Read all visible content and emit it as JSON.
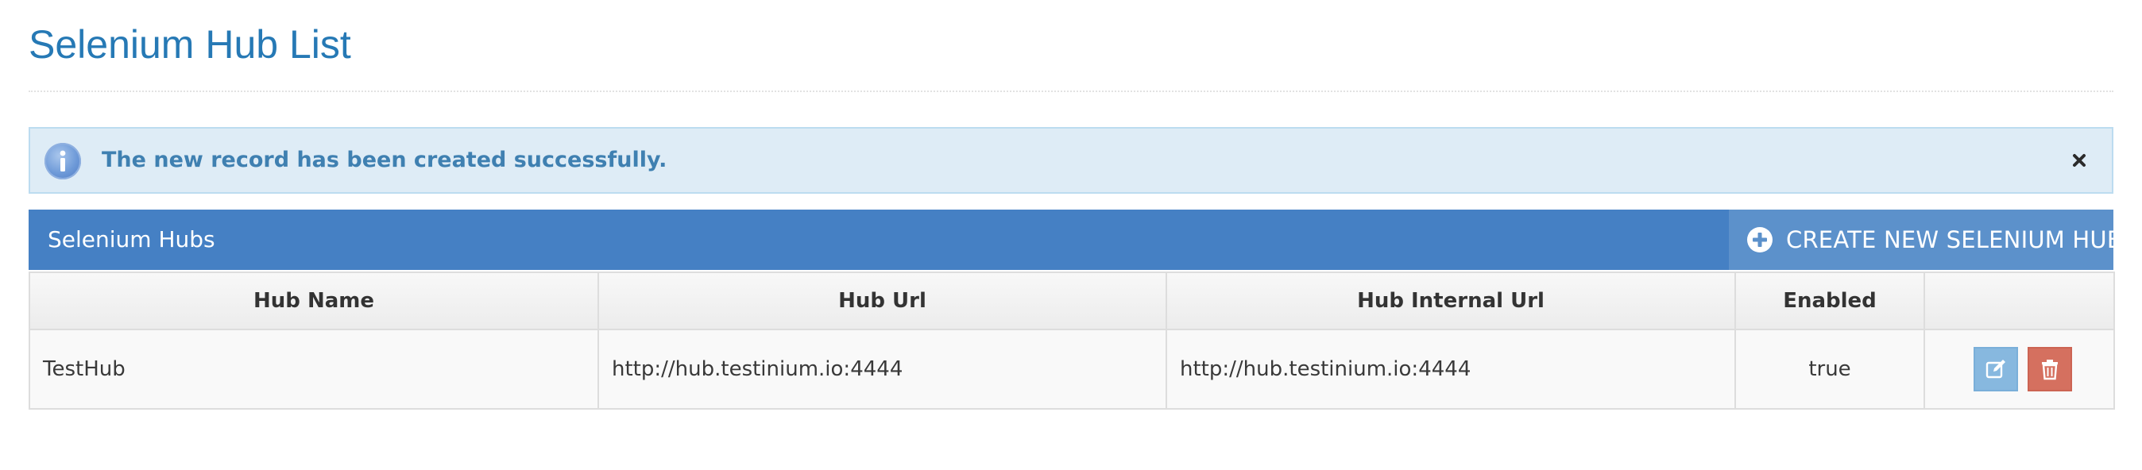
{
  "page": {
    "title": "Selenium Hub List"
  },
  "alert": {
    "message": "The new record has been created successfully.",
    "icon": "info-icon",
    "close_icon": "close-icon"
  },
  "panel": {
    "title": "Selenium Hubs",
    "create_button_label": "CREATE NEW SELENIUM HUB",
    "create_icon": "plus-circle-icon"
  },
  "table": {
    "headers": [
      "Hub Name",
      "Hub Url",
      "Hub Internal Url",
      "Enabled",
      ""
    ],
    "rows": [
      {
        "hub_name": "TestHub",
        "hub_url": "http://hub.testinium.io:4444",
        "hub_internal_url": "http://hub.testinium.io:4444",
        "enabled": "true",
        "actions": [
          "edit-icon",
          "trash-icon"
        ]
      }
    ]
  },
  "colors": {
    "title": "#2679b5",
    "alert_bg": "#deecf6",
    "alert_text": "#3f80b1",
    "panel_bar": "#4580c4",
    "create_button": "#5c91cb",
    "edit_button": "#87b8df",
    "delete_button": "#d5705f"
  }
}
